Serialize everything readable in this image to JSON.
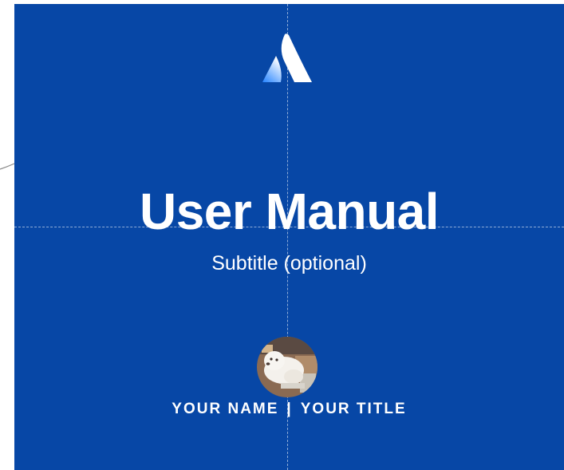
{
  "colors": {
    "slide_background": "#0747A6",
    "text": "#FFFFFF",
    "logo_gradient_start": "#2684FF",
    "logo_gradient_end": "#FFFFFF"
  },
  "logo": {
    "icon": "atlassian-logo-icon"
  },
  "title": "User Manual",
  "subtitle": "Subtitle (optional)",
  "avatar": {
    "icon": "profile-photo-dog"
  },
  "byline": {
    "name": "YOUR NAME",
    "separator": "|",
    "role": "YOUR TITLE"
  }
}
